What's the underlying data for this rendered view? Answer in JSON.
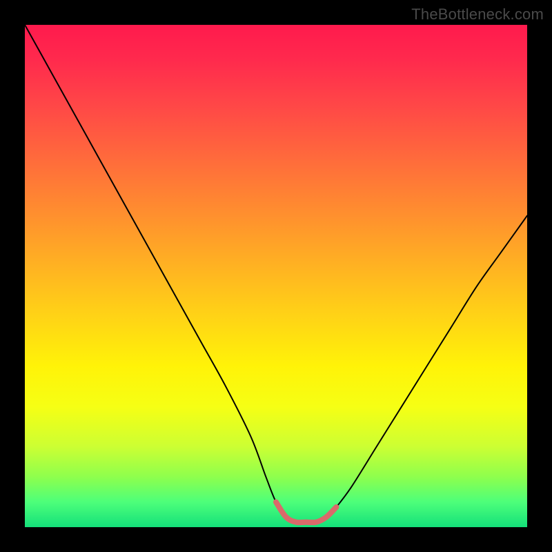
{
  "watermark": "TheBottleneck.com",
  "colors": {
    "curve_stroke": "#000000",
    "highlight_stroke": "#d96a6a",
    "background_black": "#000000"
  },
  "chart_data": {
    "type": "line",
    "title": "",
    "xlabel": "",
    "ylabel": "",
    "xlim": [
      0,
      100
    ],
    "ylim": [
      0,
      100
    ],
    "series": [
      {
        "name": "bottleneck-curve",
        "x": [
          0,
          5,
          10,
          15,
          20,
          25,
          30,
          35,
          40,
          45,
          48,
          50,
          52,
          54,
          56,
          58,
          60,
          62,
          65,
          70,
          75,
          80,
          85,
          90,
          95,
          100
        ],
        "y": [
          100,
          91,
          82,
          73,
          64,
          55,
          46,
          37,
          28,
          18,
          10,
          5,
          2,
          1,
          1,
          1,
          2,
          4,
          8,
          16,
          24,
          32,
          40,
          48,
          55,
          62
        ]
      },
      {
        "name": "optimal-range-highlight",
        "x": [
          50,
          52,
          54,
          56,
          58,
          60,
          62
        ],
        "y": [
          5,
          2,
          1,
          1,
          1,
          2,
          4
        ]
      }
    ],
    "annotations": []
  }
}
